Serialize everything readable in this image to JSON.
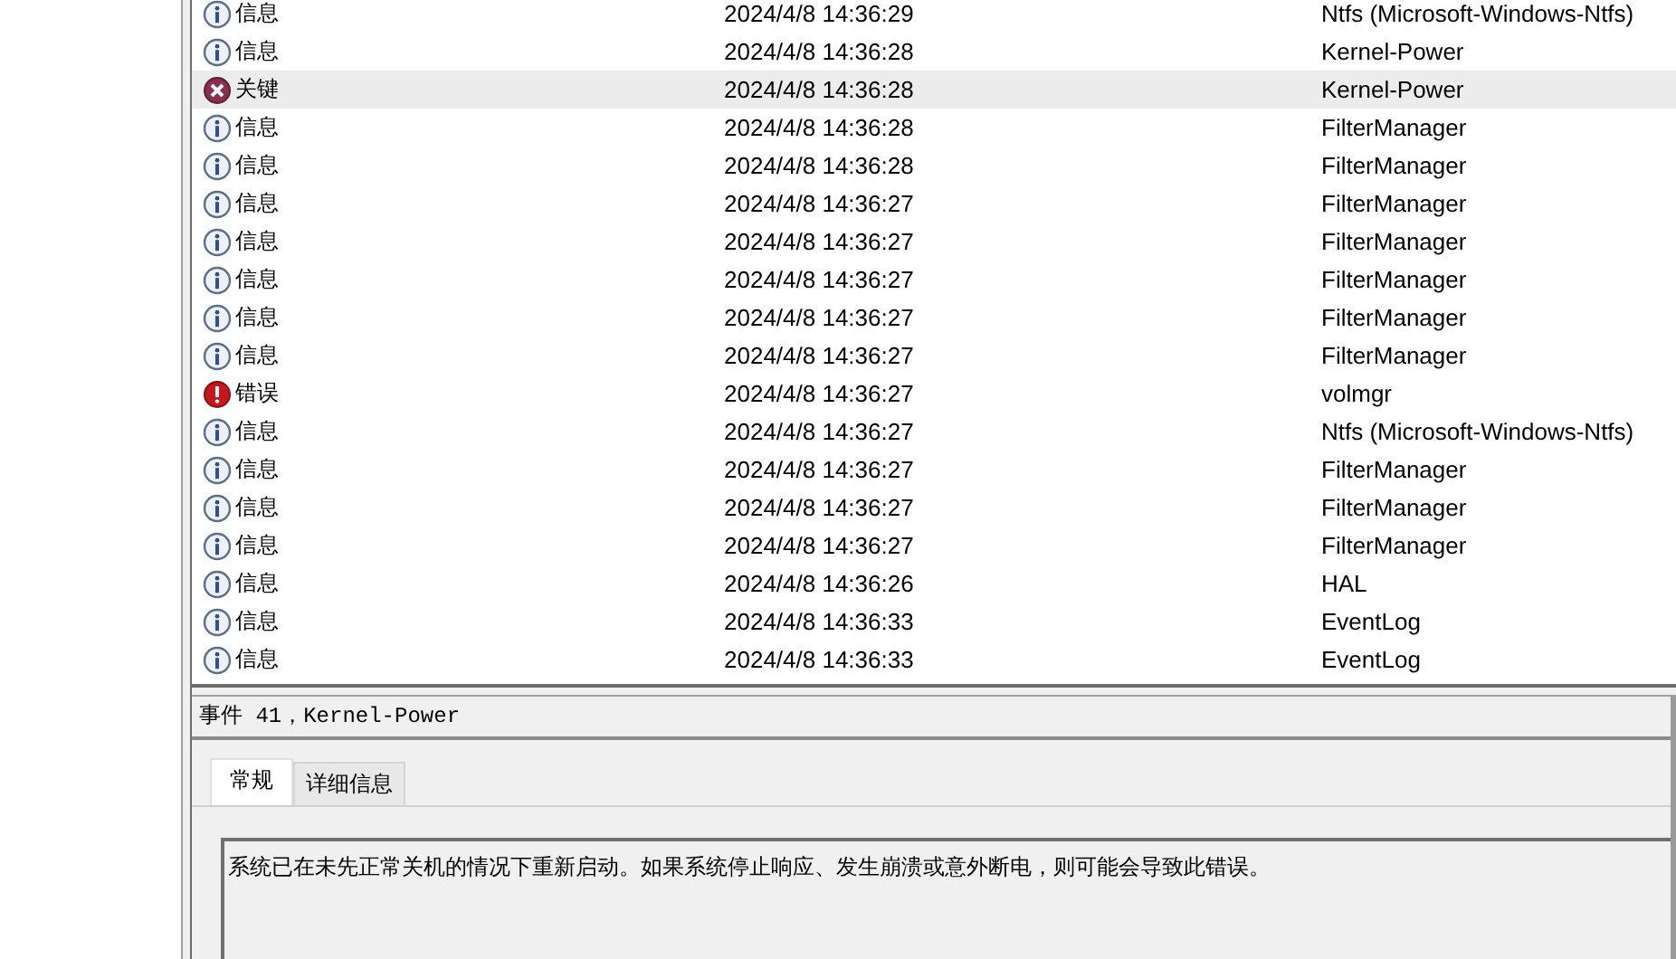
{
  "events": [
    {
      "kind": "info",
      "level": "信息",
      "date": "2024/4/8 14:36:29",
      "source": "Ntfs (Microsoft-Windows-Ntfs)",
      "selected": false
    },
    {
      "kind": "info",
      "level": "信息",
      "date": "2024/4/8 14:36:28",
      "source": "Kernel-Power",
      "selected": false
    },
    {
      "kind": "critical",
      "level": "关键",
      "date": "2024/4/8 14:36:28",
      "source": "Kernel-Power",
      "selected": true
    },
    {
      "kind": "info",
      "level": "信息",
      "date": "2024/4/8 14:36:28",
      "source": "FilterManager",
      "selected": false
    },
    {
      "kind": "info",
      "level": "信息",
      "date": "2024/4/8 14:36:28",
      "source": "FilterManager",
      "selected": false
    },
    {
      "kind": "info",
      "level": "信息",
      "date": "2024/4/8 14:36:27",
      "source": "FilterManager",
      "selected": false
    },
    {
      "kind": "info",
      "level": "信息",
      "date": "2024/4/8 14:36:27",
      "source": "FilterManager",
      "selected": false
    },
    {
      "kind": "info",
      "level": "信息",
      "date": "2024/4/8 14:36:27",
      "source": "FilterManager",
      "selected": false
    },
    {
      "kind": "info",
      "level": "信息",
      "date": "2024/4/8 14:36:27",
      "source": "FilterManager",
      "selected": false
    },
    {
      "kind": "info",
      "level": "信息",
      "date": "2024/4/8 14:36:27",
      "source": "FilterManager",
      "selected": false
    },
    {
      "kind": "error",
      "level": "错误",
      "date": "2024/4/8 14:36:27",
      "source": "volmgr",
      "selected": false
    },
    {
      "kind": "info",
      "level": "信息",
      "date": "2024/4/8 14:36:27",
      "source": "Ntfs (Microsoft-Windows-Ntfs)",
      "selected": false
    },
    {
      "kind": "info",
      "level": "信息",
      "date": "2024/4/8 14:36:27",
      "source": "FilterManager",
      "selected": false
    },
    {
      "kind": "info",
      "level": "信息",
      "date": "2024/4/8 14:36:27",
      "source": "FilterManager",
      "selected": false
    },
    {
      "kind": "info",
      "level": "信息",
      "date": "2024/4/8 14:36:27",
      "source": "FilterManager",
      "selected": false
    },
    {
      "kind": "info",
      "level": "信息",
      "date": "2024/4/8 14:36:26",
      "source": "HAL",
      "selected": false
    },
    {
      "kind": "info",
      "level": "信息",
      "date": "2024/4/8 14:36:33",
      "source": "EventLog",
      "selected": false
    },
    {
      "kind": "info",
      "level": "信息",
      "date": "2024/4/8 14:36:33",
      "source": "EventLog",
      "selected": false
    }
  ],
  "detail": {
    "title": "事件 41，Kernel-Power",
    "tabs": [
      {
        "label": "常规",
        "selected": true
      },
      {
        "label": "详细信息",
        "selected": false
      }
    ],
    "description": "系统已在未先正常关机的情况下重新启动。如果系统停止响应、发生崩溃或意外断电，则可能会导致此错误。"
  }
}
